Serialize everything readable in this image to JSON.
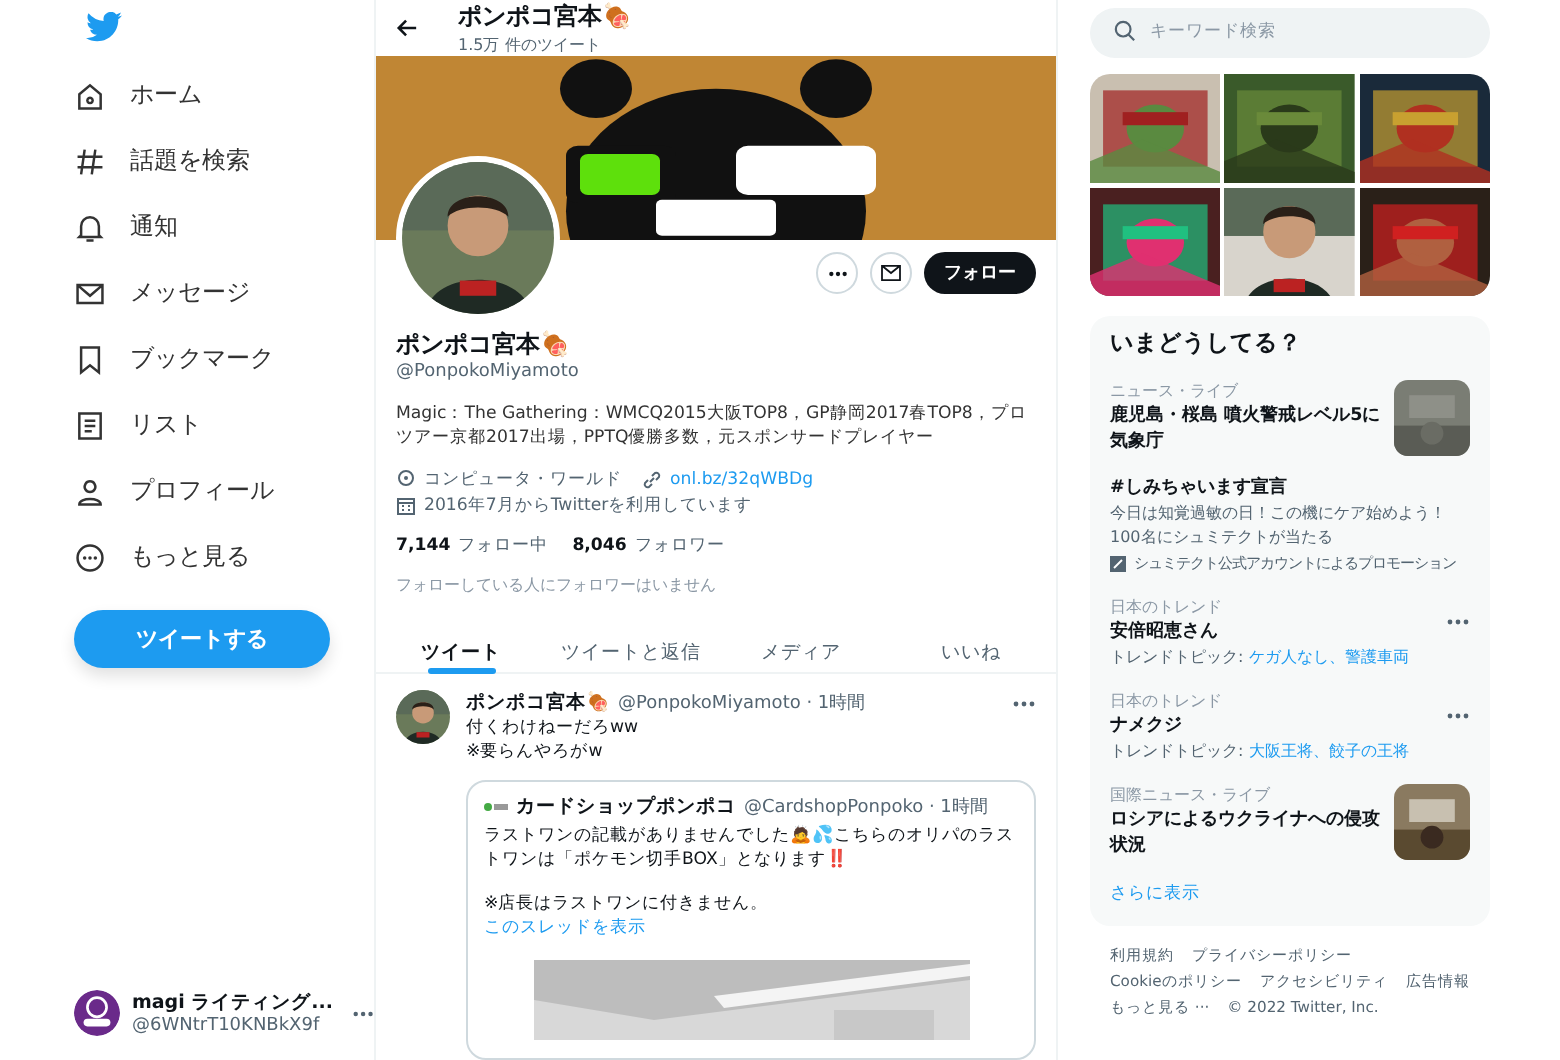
{
  "sidebar": {
    "items": [
      {
        "label": "ホーム"
      },
      {
        "label": "話題を検索"
      },
      {
        "label": "通知"
      },
      {
        "label": "メッセージ"
      },
      {
        "label": "ブックマーク"
      },
      {
        "label": "リスト"
      },
      {
        "label": "プロフィール"
      },
      {
        "label": "もっと見る"
      }
    ],
    "tweet_button": "ツイートする",
    "account": {
      "name": "magi ライティング...",
      "handle": "@6WNtrT10KNBkX9f"
    }
  },
  "header": {
    "title": "ポンポコ宮本🍖",
    "subtitle": "1.5万 件のツイート"
  },
  "profile": {
    "follow_button": "フォロー",
    "name": "ポンポコ宮本🍖",
    "handle": "@PonpokoMiyamoto",
    "bio": "Magic：The Gathering：WMCQ2015大阪TOP8，GP静岡2017春TOP8，プロツアー京都2017出場，PPTQ優勝多数，元スポンサードプレイヤー",
    "location": "コンピュータ・ワールド",
    "link": "onl.bz/32qWBDg",
    "joined": "2016年7月からTwitterを利用しています",
    "following_count": "7,144",
    "following_label": "フォロー中",
    "followers_count": "8,046",
    "followers_label": "フォロワー",
    "follow_note": "フォローしている人にフォロワーはいません"
  },
  "tabs": [
    {
      "label": "ツイート",
      "selected": true
    },
    {
      "label": "ツイートと返信",
      "selected": false
    },
    {
      "label": "メディア",
      "selected": false
    },
    {
      "label": "いいね",
      "selected": false
    }
  ],
  "tweet": {
    "name": "ポンポコ宮本🍖",
    "meta": "@PonpokoMiyamoto · 1時間",
    "lines": [
      "付くわけねーだろww",
      "※要らんやろがw"
    ],
    "quote": {
      "name": "カードショップポンポコ",
      "meta": "@CardshopPonpoko · 1時間",
      "text": "ラストワンの記載がありませんでした🙇💦こちらのオリパのラストワンは「ポケモン切手BOX」となります‼️",
      "note": "※店長はラストワンに付きません。",
      "thread_link": "このスレッドを表示"
    }
  },
  "search": {
    "placeholder": "キーワード検索"
  },
  "trends": {
    "title": "いまどうしてる？",
    "items": [
      {
        "kind": "news",
        "category": "ニュース・ライブ",
        "title": "鹿児島・桜島 噴火警戒レベル5に気象庁"
      },
      {
        "kind": "promo",
        "title": "#しみちゃいます宣言",
        "description": "今日は知覚過敏の日！この機にケア始めよう！100名にシュミテクトが当たる",
        "promoter": "シュミテクト公式アカウントによるプロモーション"
      },
      {
        "kind": "trend",
        "category": "日本のトレンド",
        "title": "安倍昭恵さん",
        "topic_label": "トレンドトピック:",
        "topics": "ケガ人なし、警護車両"
      },
      {
        "kind": "trend",
        "category": "日本のトレンド",
        "title": "ナメクジ",
        "topic_label": "トレンドトピック:",
        "topics": "大阪王将、餃子の王将"
      },
      {
        "kind": "news",
        "category": "国際ニュース・ライブ",
        "title": "ロシアによるウクライナへの侵攻状況"
      }
    ],
    "show_more": "さらに表示"
  },
  "footer": {
    "links": [
      "利用規約",
      "プライバシーポリシー",
      "Cookieのポリシー",
      "アクセシビリティ",
      "広告情報",
      "もっと見る ···"
    ],
    "copyright": "© 2022 Twitter, Inc."
  }
}
